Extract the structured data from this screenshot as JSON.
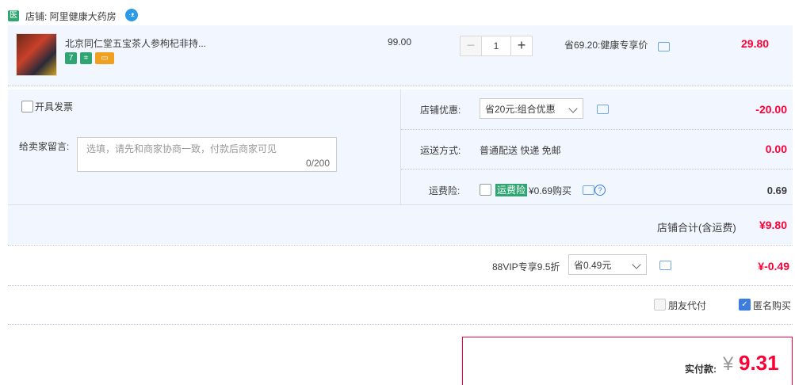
{
  "store": {
    "badge": "医",
    "name": "店铺: 阿里健康大药房"
  },
  "item": {
    "title": "北京同仁堂五宝茶人参枸杞非持...",
    "services": [
      {
        "label": "7",
        "color": "#2fa672"
      },
      {
        "label": "⌗",
        "color": "#2fa672"
      },
      {
        "label": "▭",
        "color": "#f0a020"
      }
    ],
    "unit_price": "99.00",
    "quantity": "1",
    "promo": "省69.20:健康专享价",
    "subtotal": "29.80"
  },
  "invoice": {
    "label": "开具发票"
  },
  "message": {
    "label": "给卖家留言:",
    "placeholder": "选填，请先和商家协商一致，付款后商家可见",
    "counter": "0/200"
  },
  "store_discount": {
    "label": "店铺优惠:",
    "selected": "省20元:组合优惠",
    "amount": "-20.00"
  },
  "shipping": {
    "label": "运送方式:",
    "value": "普通配送 快递 免邮",
    "amount": "0.00"
  },
  "insurance": {
    "label": "运费险:",
    "badge": "运费险",
    "price": "¥0.69购买",
    "amount": "0.69"
  },
  "store_total": {
    "label": "店铺合计(含运费)",
    "amount": "¥9.80"
  },
  "vip": {
    "label": "88VIP专享9.5折",
    "selected": "省0.49元",
    "amount": "¥-0.49"
  },
  "friend_pay": {
    "label": "朋友代付"
  },
  "anonymous": {
    "label": "匿名购买"
  },
  "payment": {
    "label": "实付款:",
    "currency": "¥",
    "amount": "9.31"
  }
}
